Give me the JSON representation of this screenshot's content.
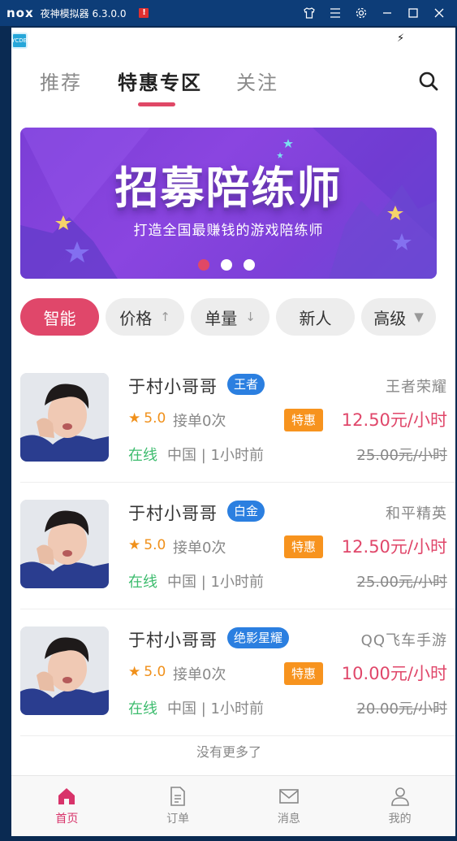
{
  "window": {
    "logo": "nox",
    "title": "夜神模拟器 6.3.0.0",
    "warn": "!",
    "icons": [
      "shirt-icon",
      "menu-icon",
      "gear-icon",
      "minimize-icon",
      "maximize-icon",
      "close-icon"
    ]
  },
  "status": {
    "app_icon_text": "YCDB"
  },
  "tabs": [
    {
      "label": "推荐",
      "active": false
    },
    {
      "label": "特惠专区",
      "active": true
    },
    {
      "label": "关注",
      "active": false
    }
  ],
  "banner": {
    "title": "招募陪练师",
    "subtitle": "打造全国最赚钱的游戏陪练师",
    "slides": 3,
    "active_slide": 0
  },
  "filters": [
    {
      "label": "智能",
      "active": true,
      "arrow": ""
    },
    {
      "label": "价格",
      "active": false,
      "arrow": "↑"
    },
    {
      "label": "单量",
      "active": false,
      "arrow": "↓"
    },
    {
      "label": "新人",
      "active": false,
      "arrow": ""
    },
    {
      "label": "高级",
      "active": false,
      "arrow": "▼"
    }
  ],
  "players": [
    {
      "name": "于村小哥哥",
      "rank": "王者",
      "game": "王者荣耀",
      "rating": "5.0",
      "orders": "接单0次",
      "promo": "特惠",
      "price": "12.50元/小时",
      "status": "在线",
      "location": "中国 | 1小时前",
      "original_price": "25.00元/小时"
    },
    {
      "name": "于村小哥哥",
      "rank": "白金",
      "game": "和平精英",
      "rating": "5.0",
      "orders": "接单0次",
      "promo": "特惠",
      "price": "12.50元/小时",
      "status": "在线",
      "location": "中国 | 1小时前",
      "original_price": "25.00元/小时"
    },
    {
      "name": "于村小哥哥",
      "rank": "绝影星耀",
      "game": "QQ飞车手游",
      "rating": "5.0",
      "orders": "接单0次",
      "promo": "特惠",
      "price": "10.00元/小时",
      "status": "在线",
      "location": "中国 | 1小时前",
      "original_price": "20.00元/小时"
    }
  ],
  "end_note": "没有更多了",
  "bottom_nav": [
    {
      "label": "首页",
      "icon": "home-icon",
      "active": true
    },
    {
      "label": "订单",
      "icon": "document-icon",
      "active": false
    },
    {
      "label": "消息",
      "icon": "mail-icon",
      "active": false
    },
    {
      "label": "我的",
      "icon": "user-icon",
      "active": false
    }
  ],
  "colors": {
    "accent": "#e0476a",
    "promo": "#f7931e",
    "online": "#3dbc6e",
    "rank_badge": "#2b7fe0",
    "titlebar": "#0d3d78"
  }
}
